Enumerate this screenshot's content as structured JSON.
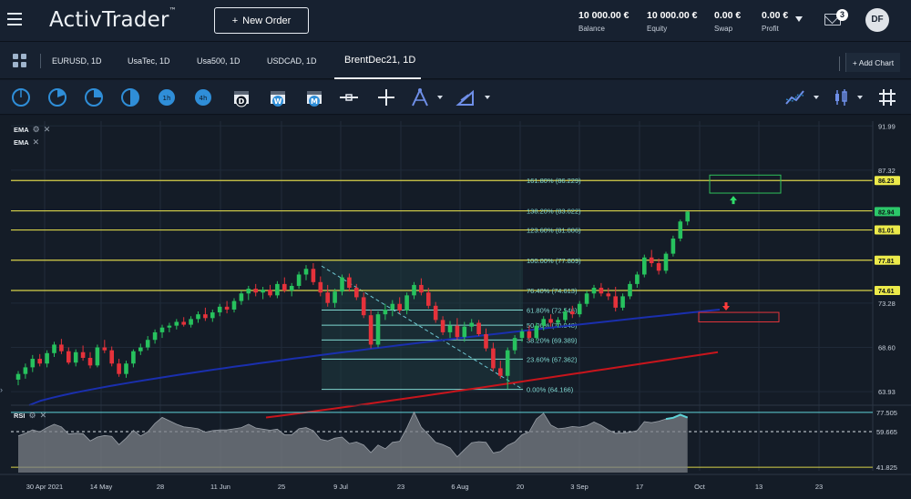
{
  "app": {
    "logo": "ActivTrader",
    "trademark": "™"
  },
  "header": {
    "new_order_label": "New Order",
    "new_order_plus": "+",
    "stats": [
      {
        "value": "10 000.00 €",
        "label": "Balance"
      },
      {
        "value": "10 000.00 €",
        "label": "Equity"
      },
      {
        "value": "0.00 €",
        "label": "Swap"
      },
      {
        "value": "0.00 €",
        "label": "Profit"
      }
    ],
    "messages_count": "3",
    "avatar_initials": "DF"
  },
  "tabs": [
    {
      "label": "EURUSD, 1D"
    },
    {
      "label": "UsaTec, 1D"
    },
    {
      "label": "Usa500, 1D"
    },
    {
      "label": "USDCAD, 1D"
    },
    {
      "label": "BrentDec21, 1D"
    }
  ],
  "add_chart_label": "+ Add Chart",
  "toolbar": {
    "icons": [
      "timeframe-1-icon",
      "timeframe-2-icon",
      "timeframe-3-icon",
      "timeframe-4-icon",
      "timeframe-5-icon",
      "timeframe-6-icon",
      "daily-calendar-icon",
      "weekly-calendar-icon",
      "monthly-calendar-icon",
      "horizontal-line-icon",
      "crosshair-icon",
      "fibonacci-tool-icon",
      "trendline-tool-icon",
      "indicator-icon",
      "chart-type-icon",
      "grid-icon"
    ],
    "calendar_letters": [
      "D",
      "W",
      "M"
    ]
  },
  "indicators": {
    "ema1": "EMA",
    "ema2": "EMA",
    "rsi": "RSI"
  },
  "colors": {
    "up": "#27c25e",
    "down": "#e5323b",
    "ema_fast": "#1a2fae",
    "ema_slow": "#c8151c",
    "fib": "#7fd7d0",
    "level": "#d8d24a",
    "rsi_line": "#5fd3d8"
  },
  "chart_data": {
    "type": "candlestick",
    "ylim": [
      62.5,
      92.5
    ],
    "y_ticks": [
      "91.99",
      "87.32",
      "73.28",
      "68.60",
      "63.93"
    ],
    "x_ticks": [
      "30 Apr 2021",
      "14 May",
      "28",
      "11 Jun",
      "25",
      "9 Jul",
      "23",
      "6 Aug",
      "20",
      "3 Sep",
      "17",
      "Oct",
      "13",
      "23"
    ],
    "price_badges": [
      {
        "value": "86.23",
        "price": 86.23
      },
      {
        "value": "82.94",
        "price": 82.94
      },
      {
        "value": "81.01",
        "price": 81.01
      },
      {
        "value": "77.81",
        "price": 77.81
      },
      {
        "value": "74.61",
        "price": 74.61
      }
    ],
    "fib_levels": [
      {
        "label": "161.80% (86.229)",
        "price": 86.229,
        "style": "level"
      },
      {
        "label": "138.20% (83.022)",
        "price": 83.022,
        "style": "level"
      },
      {
        "label": "123.60% (81.006)",
        "price": 81.006,
        "style": "level"
      },
      {
        "label": "100.00% (77.809)",
        "price": 77.809,
        "style": "level"
      },
      {
        "label": "76.40% (74.613)",
        "price": 74.613,
        "style": "level"
      },
      {
        "label": "61.80% (72.546)",
        "price": 72.546,
        "style": "fib"
      },
      {
        "label": "50.00% (70.948)",
        "price": 70.948,
        "style": "fib"
      },
      {
        "label": "38.20% (69.389)",
        "price": 69.389,
        "style": "fib"
      },
      {
        "label": "23.60% (67.362)",
        "price": 67.362,
        "style": "fib"
      },
      {
        "label": "0.00% (64.166)",
        "price": 64.166,
        "style": "fib"
      }
    ],
    "candles": [
      [
        65.2,
        66.1,
        64.6,
        65.8
      ],
      [
        65.8,
        66.9,
        65.3,
        66.5
      ],
      [
        66.5,
        67.8,
        66.0,
        67.4
      ],
      [
        67.4,
        67.9,
        66.6,
        66.9
      ],
      [
        66.9,
        68.3,
        66.5,
        68.0
      ],
      [
        68.0,
        69.2,
        67.6,
        68.9
      ],
      [
        68.9,
        69.5,
        67.9,
        68.2
      ],
      [
        68.2,
        68.6,
        66.8,
        67.0
      ],
      [
        67.0,
        68.4,
        66.6,
        68.1
      ],
      [
        68.1,
        68.8,
        67.2,
        67.5
      ],
      [
        67.5,
        68.1,
        66.4,
        66.7
      ],
      [
        66.7,
        68.9,
        66.5,
        68.6
      ],
      [
        68.6,
        69.4,
        68.0,
        68.3
      ],
      [
        68.3,
        68.7,
        66.6,
        66.9
      ],
      [
        66.9,
        67.4,
        65.5,
        65.8
      ],
      [
        65.8,
        67.2,
        65.4,
        66.9
      ],
      [
        66.9,
        68.4,
        66.5,
        68.2
      ],
      [
        68.2,
        69.0,
        67.8,
        68.6
      ],
      [
        68.6,
        69.8,
        68.3,
        69.4
      ],
      [
        69.4,
        70.5,
        69.0,
        70.2
      ],
      [
        70.2,
        71.0,
        69.6,
        70.7
      ],
      [
        70.7,
        71.2,
        70.2,
        70.9
      ],
      [
        70.9,
        71.6,
        70.5,
        71.3
      ],
      [
        71.3,
        71.8,
        70.8,
        71.0
      ],
      [
        71.0,
        71.9,
        70.7,
        71.6
      ],
      [
        71.6,
        72.4,
        71.2,
        72.1
      ],
      [
        72.1,
        72.8,
        71.4,
        71.7
      ],
      [
        71.7,
        72.6,
        71.3,
        72.3
      ],
      [
        72.3,
        73.2,
        71.9,
        72.9
      ],
      [
        72.9,
        73.5,
        72.2,
        72.6
      ],
      [
        72.6,
        73.8,
        72.3,
        73.5
      ],
      [
        73.5,
        74.6,
        73.1,
        74.3
      ],
      [
        74.3,
        75.1,
        73.6,
        74.8
      ],
      [
        74.8,
        75.3,
        74.0,
        74.4
      ],
      [
        74.4,
        75.0,
        73.7,
        74.7
      ],
      [
        74.7,
        75.2,
        73.9,
        74.1
      ],
      [
        74.1,
        75.6,
        73.8,
        75.3
      ],
      [
        75.3,
        76.0,
        74.4,
        74.6
      ],
      [
        74.6,
        75.4,
        74.0,
        75.1
      ],
      [
        75.1,
        76.6,
        74.8,
        76.3
      ],
      [
        76.3,
        77.3,
        75.7,
        76.9
      ],
      [
        76.9,
        77.5,
        75.2,
        75.5
      ],
      [
        75.5,
        76.1,
        74.0,
        74.4
      ],
      [
        74.4,
        75.2,
        72.9,
        73.3
      ],
      [
        73.3,
        74.8,
        72.8,
        74.5
      ],
      [
        74.5,
        76.3,
        74.1,
        76.0
      ],
      [
        76.0,
        76.4,
        74.5,
        74.9
      ],
      [
        74.9,
        75.3,
        73.6,
        73.9
      ],
      [
        73.9,
        74.4,
        71.7,
        72.0
      ],
      [
        72.0,
        72.6,
        68.5,
        68.9
      ],
      [
        68.9,
        72.4,
        68.6,
        72.1
      ],
      [
        72.1,
        73.2,
        71.5,
        72.6
      ],
      [
        72.6,
        73.6,
        71.9,
        73.2
      ],
      [
        73.2,
        73.9,
        72.2,
        72.5
      ],
      [
        72.5,
        74.4,
        72.1,
        74.1
      ],
      [
        74.1,
        75.5,
        73.7,
        75.2
      ],
      [
        75.2,
        75.9,
        74.1,
        74.4
      ],
      [
        74.4,
        74.9,
        72.7,
        73.0
      ],
      [
        73.0,
        73.4,
        71.2,
        71.5
      ],
      [
        71.5,
        71.9,
        69.9,
        70.2
      ],
      [
        70.2,
        71.4,
        69.6,
        70.9
      ],
      [
        70.9,
        71.7,
        69.4,
        69.7
      ],
      [
        69.7,
        71.3,
        69.2,
        70.8
      ],
      [
        70.8,
        71.6,
        70.3,
        71.2
      ],
      [
        71.2,
        71.5,
        69.8,
        70.0
      ],
      [
        70.0,
        70.6,
        68.2,
        68.5
      ],
      [
        68.5,
        69.1,
        66.1,
        66.4
      ],
      [
        66.4,
        67.2,
        65.3,
        65.6
      ],
      [
        65.6,
        68.6,
        64.2,
        68.3
      ],
      [
        68.3,
        69.9,
        67.9,
        69.6
      ],
      [
        69.6,
        70.6,
        69.2,
        70.3
      ],
      [
        70.3,
        70.9,
        69.3,
        69.6
      ],
      [
        69.6,
        71.2,
        69.3,
        70.9
      ],
      [
        70.9,
        71.9,
        70.4,
        71.6
      ],
      [
        71.6,
        72.1,
        70.8,
        71.2
      ],
      [
        71.2,
        71.8,
        70.7,
        71.5
      ],
      [
        71.5,
        72.7,
        71.2,
        72.4
      ],
      [
        72.4,
        73.0,
        71.7,
        72.1
      ],
      [
        72.1,
        73.5,
        71.8,
        73.2
      ],
      [
        73.2,
        74.6,
        72.9,
        74.3
      ],
      [
        74.3,
        75.2,
        73.8,
        74.9
      ],
      [
        74.9,
        75.4,
        74.0,
        74.3
      ],
      [
        74.3,
        74.9,
        73.6,
        74.0
      ],
      [
        74.0,
        75.0,
        72.4,
        72.8
      ],
      [
        72.8,
        74.3,
        72.5,
        74.0
      ],
      [
        74.0,
        75.6,
        73.7,
        75.3
      ],
      [
        75.3,
        76.6,
        74.9,
        76.3
      ],
      [
        76.3,
        78.4,
        76.0,
        78.1
      ],
      [
        78.1,
        78.9,
        77.1,
        77.5
      ],
      [
        77.5,
        78.0,
        76.3,
        76.7
      ],
      [
        76.7,
        78.7,
        76.4,
        78.5
      ],
      [
        78.5,
        80.4,
        78.2,
        80.1
      ],
      [
        80.1,
        82.1,
        79.8,
        81.9
      ],
      [
        81.9,
        83.0,
        81.5,
        82.94
      ]
    ],
    "ema_fast": {
      "start": 62.5,
      "end": 72.6
    },
    "ema_slow": {
      "start": 61.2,
      "end": 68.1
    },
    "rsi": {
      "levels": [
        "77.505",
        "59.665",
        "41.825"
      ],
      "ylim": [
        25,
        82
      ]
    }
  }
}
